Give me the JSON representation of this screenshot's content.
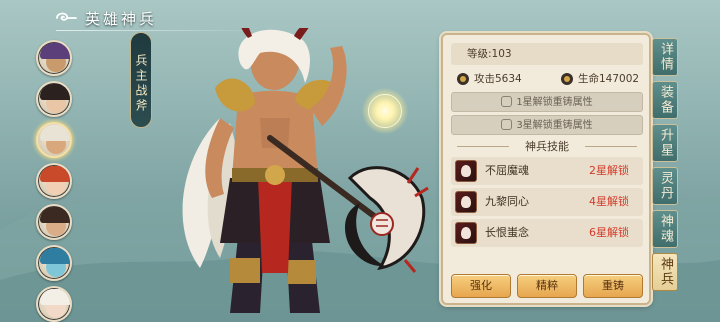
{
  "header": {
    "title": "英雄神兵"
  },
  "weapon_tag": "兵主战斧",
  "heroes": [
    {
      "name": "hero-1",
      "hair": "#5b3f7a",
      "skin": "#c99a6b"
    },
    {
      "name": "hero-2",
      "hair": "#2b2220",
      "skin": "#e8c6a6"
    },
    {
      "name": "hero-3",
      "hair": "#e9e3d6",
      "skin": "#d9a77c",
      "selected": true
    },
    {
      "name": "hero-4",
      "hair": "#c84a2a",
      "skin": "#f0cfb4"
    },
    {
      "name": "hero-5",
      "hair": "#3a2a22",
      "skin": "#d8ad88"
    },
    {
      "name": "hero-6",
      "hair": "#2f7da0",
      "skin": "#7fc7d8"
    },
    {
      "name": "hero-7",
      "hair": "#f3efe6",
      "skin": "#f2d8c6"
    }
  ],
  "panel": {
    "level_label": "等级:",
    "level_value": "103",
    "attack_label": "攻击",
    "attack_value": "5634",
    "hp_label": "生命",
    "hp_value": "147002",
    "lock1": "1星解锁重铸属性",
    "lock2": "3星解锁重铸属性",
    "skills_header": "神兵技能",
    "skills": [
      {
        "name": "不屈魔魂",
        "unlock": "2星解锁"
      },
      {
        "name": "九黎同心",
        "unlock": "4星解锁"
      },
      {
        "name": "长恨蚩念",
        "unlock": "6星解锁"
      }
    ],
    "buttons": {
      "strengthen": "强化",
      "refine": "精粹",
      "recast": "重铸"
    }
  },
  "tabs": [
    {
      "label": "详情"
    },
    {
      "label": "装备"
    },
    {
      "label": "升星"
    },
    {
      "label": "灵丹"
    },
    {
      "label": "神魂"
    },
    {
      "label": "神兵",
      "active": true
    }
  ],
  "colors": {
    "unlock_red": "#d33b2b",
    "button_gold": "#e7a64f",
    "tab_teal": "#3f6e6c"
  }
}
